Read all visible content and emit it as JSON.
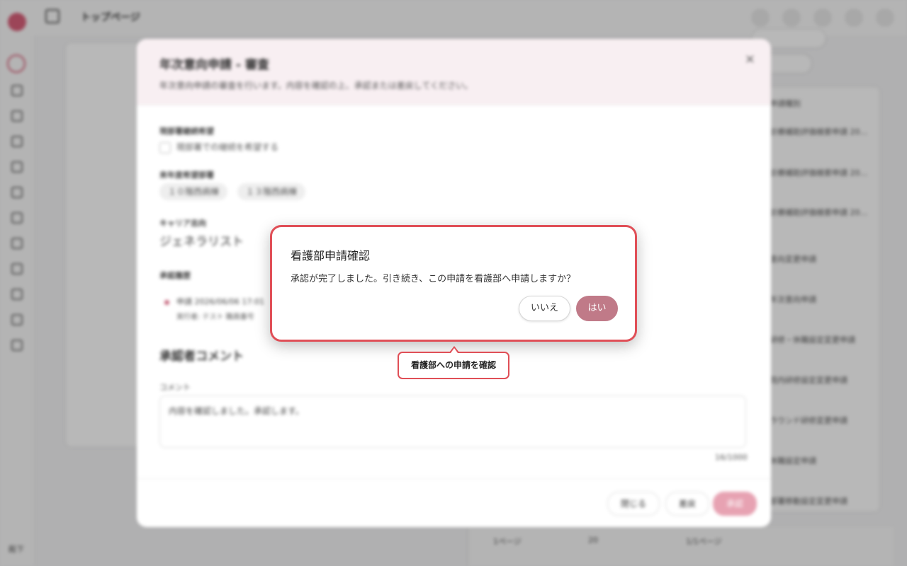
{
  "app": {
    "page_title": "トップページ",
    "sidebar_footer": "殿下"
  },
  "background": {
    "right_rows": [
      "診療補助評価検索申請 20…",
      "診療補助評価検索申請 20…",
      "診療補助評価検索申請 20…",
      "意向変更申請",
      "年次意向申請",
      "研修・休職設定変更申請",
      "院内研修設定変更申請",
      "ラウンド研修変更申請",
      "休職設定申請",
      "部署移動設定変更申請"
    ],
    "right_header": "申請種別",
    "footer_rows_label": "1ページ",
    "footer_rows_value": "20",
    "footer_page": "1/1ページ"
  },
  "modal": {
    "title": "年次意向申請 - 審査",
    "subtitle": "年次意向申請の審査を行います。内容を確認の上、承認または差戻してください。",
    "close_icon": "×",
    "section_dept_label": "現部署継続希望",
    "dept_checkbox_label": "現部署での継続を希望する",
    "section_next_label": "来年度希望部署",
    "chips": [
      "１０階西病棟",
      "１３階西病棟"
    ],
    "section_career_label": "キャリア志向",
    "career_value": "ジェネラリスト",
    "section_history_label": "承認履歴",
    "history_line1": "申請  2026/06/06 17:01",
    "history_line2": "実行者: テスト 職員番号",
    "comment_heading": "承認者コメント",
    "comment_label": "コメント",
    "comment_text": "内容を確認しました。承認します。",
    "comment_count": "16/1000",
    "btn_close": "閉じる",
    "btn_reject": "差戻",
    "btn_approve": "承認"
  },
  "confirm": {
    "title": "看護部申請確認",
    "message": "承認が完了しました。引き続き、この申請を看護部へ申請しますか？",
    "no_label": "いいえ",
    "yes_label": "はい"
  },
  "callout": {
    "text": "看護部への申請を確認"
  },
  "colors": {
    "accent": "#c07a88",
    "highlight": "#e04f57"
  }
}
